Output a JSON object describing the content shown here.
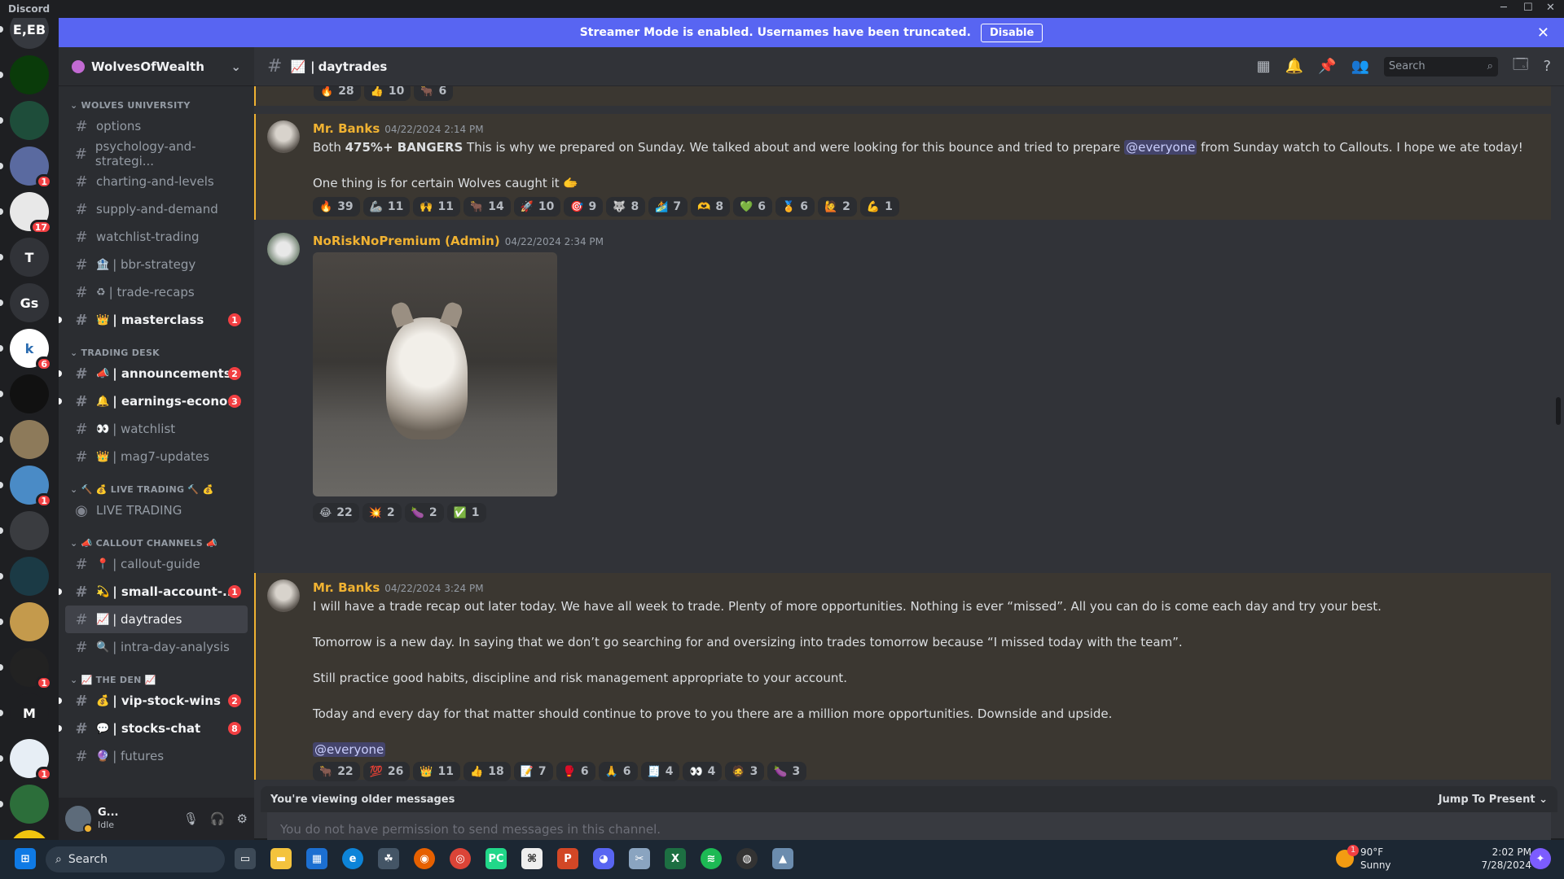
{
  "window": {
    "title": "Discord"
  },
  "banner": {
    "text": "Streamer Mode is enabled. Usernames have been truncated.",
    "button": "Disable"
  },
  "guilds": [
    {
      "label": "E,EB",
      "color": "#36393f"
    },
    {
      "label": "",
      "color": "#0a3b0a"
    },
    {
      "label": "",
      "color": "#1e4d3a"
    },
    {
      "label": "",
      "color": "#5a6aa0",
      "badge": "1"
    },
    {
      "label": "",
      "color": "#e8e8e8",
      "badge": "17"
    },
    {
      "label": "T",
      "color": "#313338"
    },
    {
      "label": "Gs",
      "color": "#313338"
    },
    {
      "label": "k",
      "color": "#ffffff",
      "badge": "6"
    },
    {
      "label": "",
      "color": "#111111"
    },
    {
      "label": "",
      "color": "#8d7a5a"
    },
    {
      "label": "",
      "color": "#4a8bc6",
      "badge": "1"
    },
    {
      "label": "",
      "color": "#3a3c40"
    },
    {
      "label": "",
      "color": "#1b3a45"
    },
    {
      "label": "",
      "color": "#c49a4c"
    },
    {
      "label": "",
      "color": "#222",
      "badge": "1"
    },
    {
      "label": "M",
      "color": "#1e1f22"
    },
    {
      "label": "",
      "color": "#e7eef5",
      "badge": "1"
    },
    {
      "label": "",
      "color": "#2c6e3a"
    },
    {
      "label": "",
      "color": "#f1c40f"
    }
  ],
  "server": {
    "name": "WolvesOfWealth"
  },
  "sidebar": {
    "cat1": "WOLVES UNIVERSITY",
    "ch": [
      {
        "name": "options",
        "emoji": ""
      },
      {
        "name": "psychology-and-strategi...",
        "emoji": ""
      },
      {
        "name": "charting-and-levels",
        "emoji": ""
      },
      {
        "name": "supply-and-demand",
        "emoji": ""
      },
      {
        "name": "watchlist-trading",
        "emoji": ""
      },
      {
        "name": "| bbr-strategy",
        "emoji": "🏦"
      },
      {
        "name": "| trade-recaps",
        "emoji": "♻"
      },
      {
        "name": "| masterclass",
        "emoji": "👑",
        "badge": "1"
      }
    ],
    "cat2": "TRADING DESK",
    "ch2": [
      {
        "name": "| announcements",
        "emoji": "📣",
        "badge": "2"
      },
      {
        "name": "| earnings-econo...",
        "emoji": "🔔",
        "badge": "3"
      },
      {
        "name": "| watchlist",
        "emoji": "👀"
      },
      {
        "name": "| mag7-updates",
        "emoji": "👑"
      }
    ],
    "cat3": "🔨 💰 LIVE TRADING 🔨 💰",
    "voice": "LIVE TRADING",
    "cat4": "📣 CALLOUT CHANNELS 📣",
    "ch4": [
      {
        "name": "| callout-guide",
        "emoji": "📍"
      },
      {
        "name": "| small-account-...",
        "emoji": "💫",
        "badge": "1"
      },
      {
        "name": "| daytrades",
        "emoji": "📈"
      },
      {
        "name": "| intra-day-analysis",
        "emoji": "🔍"
      }
    ],
    "cat5": "📈 THE DEN 📈",
    "ch5": [
      {
        "name": "| vip-stock-wins",
        "emoji": "💰",
        "badge": "2"
      },
      {
        "name": "| stocks-chat",
        "emoji": "💬",
        "badge": "8"
      },
      {
        "name": "| futures",
        "emoji": "🔮"
      }
    ]
  },
  "user": {
    "name": "G...",
    "status": "Idle"
  },
  "channel": {
    "name": "daytrades",
    "emoji": "📈",
    "search_placeholder": "Search"
  },
  "messages": {
    "prev_reactions": [
      {
        "e": "🔥",
        "c": "28"
      },
      {
        "e": "👍",
        "c": "10"
      },
      {
        "e": "🐂",
        "c": "6"
      }
    ],
    "m1": {
      "author": "Mr. Banks",
      "time": "04/22/2024 2:14 PM",
      "line1_a": "Both ",
      "line1_b": "475%+ BANGERS",
      "line1_c": " This is why we prepared on Sunday. We talked about and were looking for this bounce and tried to prepare ",
      "line1_mention": "@everyone",
      "line1_d": " from Sunday watch to Callouts. I hope we ate today!",
      "line2": "One thing is for certain Wolves caught it 🫱",
      "reactions": [
        {
          "e": "🔥",
          "c": "39"
        },
        {
          "e": "🦾",
          "c": "11"
        },
        {
          "e": "🙌",
          "c": "11"
        },
        {
          "e": "🐂",
          "c": "14"
        },
        {
          "e": "🚀",
          "c": "10"
        },
        {
          "e": "🎯",
          "c": "9"
        },
        {
          "e": "🐺",
          "c": "8"
        },
        {
          "e": "🏄",
          "c": "7"
        },
        {
          "e": "🫶",
          "c": "8"
        },
        {
          "e": "💚",
          "c": "6"
        },
        {
          "e": "🏅",
          "c": "6"
        },
        {
          "e": "🙋",
          "c": "2"
        },
        {
          "e": "💪",
          "c": "1"
        }
      ]
    },
    "m2": {
      "author": "NoRiskNoPremium (Admin)",
      "time": "04/22/2024 2:34 PM",
      "reactions": [
        {
          "e": "😂",
          "c": "22"
        },
        {
          "e": "💥",
          "c": "2"
        },
        {
          "e": "🍆",
          "c": "2"
        },
        {
          "e": "✅",
          "c": "1"
        }
      ]
    },
    "m3": {
      "author": "Mr. Banks",
      "time": "04/22/2024 3:24 PM",
      "p1": "I will have a trade recap out later today. We have all week to trade. Plenty of more opportunities. Nothing is ever “missed”. All you can do is come each day and try your best.",
      "p2": "Tomorrow is a new day. In saying that we don’t go searching for and oversizing into trades tomorrow because “I missed today with the team”.",
      "p3": "Still practice good habits, discipline and risk management appropriate to your account.",
      "p4": "Today and every day for that matter should continue to prove to you there are a million more opportunities. Downside and upside.",
      "mention": "@everyone",
      "reactions": [
        {
          "e": "🐂",
          "c": "22"
        },
        {
          "e": "💯",
          "c": "26"
        },
        {
          "e": "👑",
          "c": "11"
        },
        {
          "e": "👍",
          "c": "18"
        },
        {
          "e": "📝",
          "c": "7"
        },
        {
          "e": "🥊",
          "c": "6"
        },
        {
          "e": "🙏",
          "c": "6"
        },
        {
          "e": "🧾",
          "c": "4"
        },
        {
          "e": "👀",
          "c": "4"
        },
        {
          "e": "🧔",
          "c": "3"
        },
        {
          "e": "🍆",
          "c": "3"
        }
      ]
    }
  },
  "older": {
    "text": "You're viewing older messages",
    "jump": "Jump To Present"
  },
  "composer": {
    "placeholder": "You do not have permission to send messages in this channel."
  },
  "taskbar": {
    "search": "Search",
    "weather_temp": "90°F",
    "weather_desc": "Sunny",
    "time": "2:02 PM",
    "date": "7/28/2024",
    "weather_badge": "1"
  }
}
